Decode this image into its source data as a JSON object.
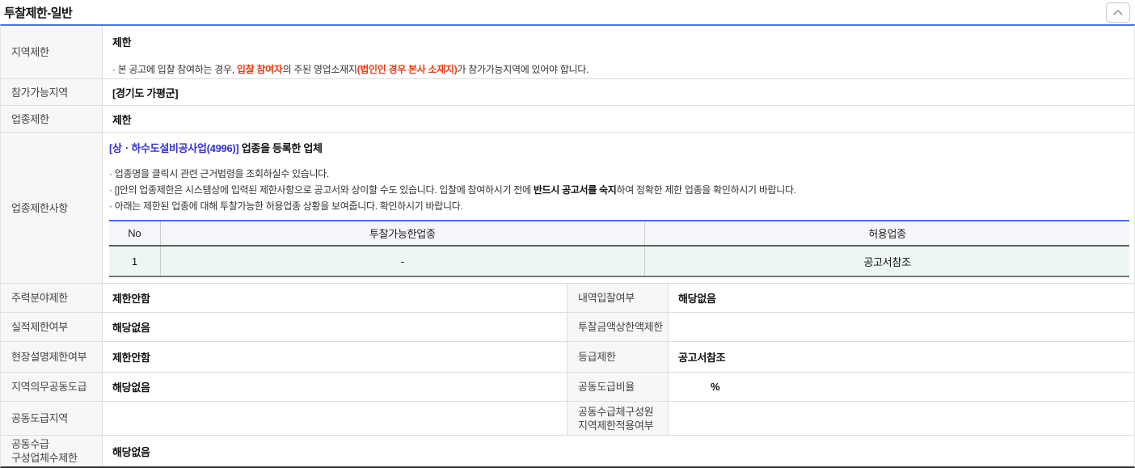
{
  "title": "투찰제한-일반",
  "collapse_button": {
    "icon": "chevron-up"
  },
  "rows": {
    "region": {
      "label": "지역제한",
      "value": "제한",
      "note_pre": "· 본 공고에 입찰 참여하는 경우, ",
      "note_red1": "입찰 참여자",
      "note_mid": "의 주된 영업소재지",
      "note_red2": "(법인인 경우 본사 소재지)",
      "note_post": "가 참가가능지역에 있어야 합니다."
    },
    "eligible_region": {
      "label": "참가가능지역",
      "value": "[경기도 가평군]"
    },
    "industry": {
      "label": "업종제한",
      "value": "제한"
    },
    "industry_detail": {
      "label": "업종제한사항",
      "link_text": "[상ㆍ하수도설비공사업(4996)]",
      "link_suffix": " 업종을 등록한 업체",
      "bullet1": "· 업종명을 클릭시 관련 근거법령을 조회하실수 있습니다.",
      "bullet2_pre": "· []안의 업종제한은 시스템상에 입력된 제한사항으로 공고서와 상이할 수도 있습니다. 입찰에 참여하시기 전에 ",
      "bullet2_bold": "반드시 공고서를 숙지",
      "bullet2_post": "하여 정확한 제한 업종을 확인하시기 바랍니다.",
      "bullet3": "· 아래는 제한된 업종에 대해 투찰가능한 허용업종 상황을 보여줍니다. 확인하시기 바랍니다.",
      "allowed_table": {
        "headers": [
          "No",
          "투찰가능한업종",
          "허용업종"
        ],
        "rows": [
          [
            "1",
            "-",
            "공고서참조"
          ]
        ]
      }
    },
    "pairs": [
      {
        "l1": "주력분야제한",
        "v1": "제한안함",
        "l2": "내역입찰여부",
        "v2": "해당없음"
      },
      {
        "l1": "실적제한여부",
        "v1": "해당없음",
        "l2": "투찰금액상한액제한",
        "v2": ""
      },
      {
        "l1": "현장설명제한여부",
        "v1": "제한안함",
        "l2": "등급제한",
        "v2": "공고서참조"
      },
      {
        "l1": "지역의무공동도급",
        "v1": "해당없음",
        "l2": "공동도급비율",
        "v2": "%",
        "v2_indent": true
      },
      {
        "l1": "공동도급지역",
        "v1": "",
        "l2": "공동수급체구성원\n지역제한적용여부",
        "v2": ""
      },
      {
        "l1": "공동수급\n구성업체수제한",
        "v1": "해당없음",
        "full_width": true
      }
    ]
  },
  "colors": {
    "accent_blue": "#4a72e0",
    "link_blue": "#3333cc",
    "alert_red": "#eb3b14",
    "allowed_row_green": "#edf7f1",
    "label_bg": "#f7f7f7"
  }
}
